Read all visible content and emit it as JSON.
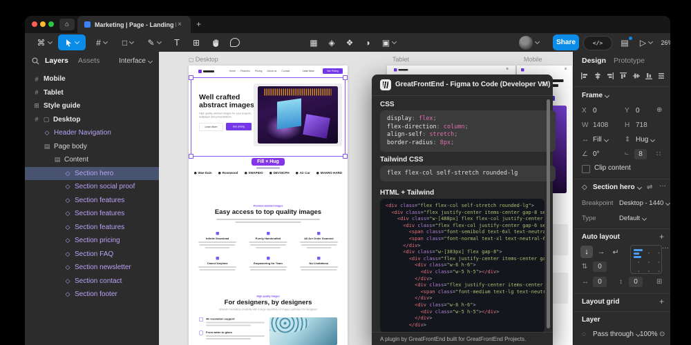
{
  "titlebar": {
    "tab_title": "Marketing | Page - Landing Page",
    "close_tab": "×",
    "new_tab": "+"
  },
  "toolbar": {
    "share": "Share",
    "dev_toggle": "</>",
    "zoom": "26%"
  },
  "left_panel": {
    "tab_layers": "Layers",
    "tab_assets": "Assets",
    "mode": "Interface",
    "layers": [
      {
        "label": "Mobile",
        "depth": 0,
        "icon": "frame",
        "bold": true
      },
      {
        "label": "Tablet",
        "depth": 0,
        "icon": "frame",
        "bold": true
      },
      {
        "label": "Style guide",
        "depth": 0,
        "icon": "grid",
        "bold": true
      },
      {
        "label": "Desktop",
        "depth": 0,
        "icon": "frame-screen",
        "bold": true
      },
      {
        "label": "Header Navigation",
        "depth": 1,
        "icon": "component",
        "component": true
      },
      {
        "label": "Page body",
        "depth": 1,
        "icon": "autolayout"
      },
      {
        "label": "Content",
        "depth": 2,
        "icon": "autolayout"
      },
      {
        "label": "Section hero",
        "depth": 3,
        "icon": "component",
        "component": true,
        "selected": true
      },
      {
        "label": "Section social proof",
        "depth": 3,
        "icon": "component",
        "component": true
      },
      {
        "label": "Section features",
        "depth": 3,
        "icon": "component",
        "component": true
      },
      {
        "label": "Section features",
        "depth": 3,
        "icon": "component",
        "component": true
      },
      {
        "label": "Section features",
        "depth": 3,
        "icon": "component",
        "component": true
      },
      {
        "label": "Section pricing",
        "depth": 3,
        "icon": "component",
        "component": true
      },
      {
        "label": "Section FAQ",
        "depth": 3,
        "icon": "component",
        "component": true
      },
      {
        "label": "Section newsletter",
        "depth": 3,
        "icon": "component",
        "component": true
      },
      {
        "label": "Section contact",
        "depth": 3,
        "icon": "component",
        "component": true
      },
      {
        "label": "Section footer",
        "depth": 3,
        "icon": "component",
        "component": true
      }
    ]
  },
  "canvas": {
    "desktop_label": "Desktop",
    "tablet_label": "Tablet",
    "mobile_label": "Mobile",
    "selection_badge": "Fill × Hug",
    "desktop": {
      "nav_links": [
        "Home",
        "Features",
        "Pricing",
        "About us",
        "Contact"
      ],
      "nav_btn_secondary": "Learn More",
      "nav_btn_primary": "See Pricing",
      "hero_heading_line1": "Well crafted",
      "hero_heading_line2": "abstract images",
      "hero_subtitle": "High quality abstract images for your projects, wallpaper and presentations.",
      "hero_btn_secondary": "Learn More",
      "hero_btn_primary": "See pricing",
      "logos": [
        "Wae Dain",
        "Rosewood",
        "SWAPIDO",
        "DEVSICPH",
        "Air Car",
        "MAKRO HARD"
      ],
      "features_label": "Premium abstract images",
      "features_heading": "Easy access to top quality images",
      "features_row1": [
        "Infinite Download",
        "Purely Handcrafted",
        "All Are Order Scanned"
      ],
      "features_row2": [
        "Cancel Anytime",
        "Empowering for Team",
        "No Limitations"
      ],
      "designers_label": "High quality images",
      "designers_heading": "For designers, by designers",
      "designers_subtitle": "Unleash boundless creativity with a large repository of images optimized for designers",
      "designers_points": [
        "4K resolution support",
        "From water to glass"
      ]
    }
  },
  "plugin_modal": {
    "title": "GreatFrontEnd - Figma to Code (Developer VM)",
    "close": "×",
    "css_label": "CSS",
    "css_lines": [
      "display: flex;",
      "flex-direction: column;",
      "align-self: stretch;",
      "border-radius: 8px;"
    ],
    "tailwind_label": "Tailwind CSS",
    "tailwind_code": "flex flex-col self-stretch rounded-lg",
    "html_label": "HTML + Tailwind",
    "html_lines": [
      "<div class=\"flex flex-col self-stretch rounded-lg\">",
      "  <div class=\"flex justify-center items-center gap-8 self-",
      "    <div class=\"w-[488px] flex flex-col justify-center gap-",
      "      <div class=\"flex flex-col justify-center gap-6 self-",
      "        <span class=\"font-semibold text-6xl text-neutral-9",
      "        <span class=\"font-normal text-xl text-neutral-600\"",
      "      </div>",
      "      <div class=\"w-[383px] flex gap-8\">",
      "        <div class=\"flex justify-center items-center gap-2",
      "          <div class=\"w-6 h-6\">",
      "            <div class=\"w-5 h-5\"></div>",
      "          </div>",
      "          <div class=\"flex justify-center items-center px-",
      "            <span class=\"font-medium text-lg text-neutral-",
      "          </div>",
      "          <div class=\"w-6 h-6\">",
      "            <div class=\"w-5 h-5\"></div>",
      "          </div>",
      "        </div>"
    ],
    "footer": "A plugin by GreatFrontEnd built for GreatFrontEnd Projects."
  },
  "right_panel": {
    "tab_design": "Design",
    "tab_prototype": "Prototype",
    "frame_label": "Frame",
    "x_label": "X",
    "x_value": "0",
    "y_label": "Y",
    "y_value": "0",
    "w_label": "W",
    "w_value": "1408",
    "h_label": "H",
    "h_value": "718",
    "fill_value": "Fill",
    "hug_value": "Hug",
    "rotation_value": "0°",
    "radius_value": "8",
    "clip_label": "Clip content",
    "component_name": "Section hero",
    "breakpoint_label": "Breakpoint",
    "breakpoint_value": "Desktop - 1440",
    "type_label": "Type",
    "type_value": "Default",
    "autolayout_label": "Auto layout",
    "gap_value": "0",
    "pad_h_value": "0",
    "pad_v_value": "0",
    "layout_grid_label": "Layout grid",
    "layer_label": "Layer",
    "blend_value": "Pass through",
    "opacity_value": "100%",
    "more_dots": "···"
  },
  "colors": {
    "accent_blue": "#0c8ce9",
    "component_purple": "#b9a2f6",
    "selection_purple": "#8a55f5",
    "badge_purple": "#8435e8"
  }
}
